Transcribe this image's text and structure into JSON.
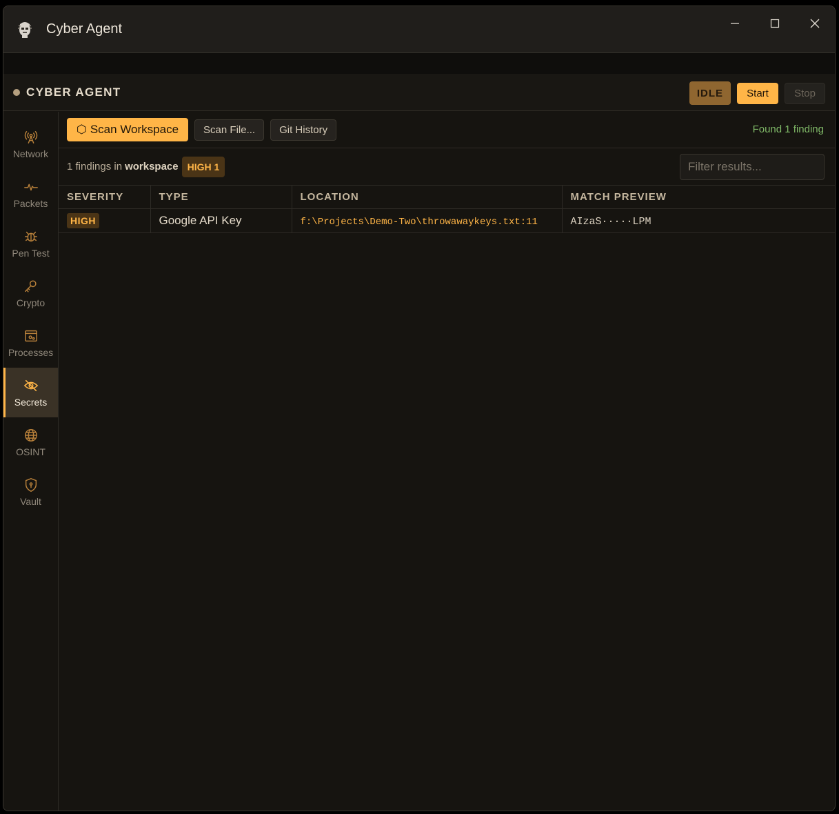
{
  "window": {
    "title": "Cyber Agent",
    "controls": [
      "minimize-icon",
      "maximize-icon",
      "close-icon"
    ]
  },
  "header": {
    "brand": "CYBER AGENT",
    "status_badge": "IDLE",
    "start_label": "Start",
    "stop_label": "Stop"
  },
  "sidebar": {
    "items": [
      {
        "label": "Network",
        "icon": "antenna-icon"
      },
      {
        "label": "Packets",
        "icon": "pulse-icon"
      },
      {
        "label": "Pen Test",
        "icon": "bug-icon"
      },
      {
        "label": "Crypto",
        "icon": "key-icon"
      },
      {
        "label": "Processes",
        "icon": "process-window-icon"
      },
      {
        "label": "Secrets",
        "icon": "eye-off-icon",
        "active": true
      },
      {
        "label": "OSINT",
        "icon": "globe-icon"
      },
      {
        "label": "Vault",
        "icon": "shield-lock-icon"
      }
    ]
  },
  "toolbar": {
    "scan_workspace_icon": "⬡",
    "scan_workspace_label": "Scan Workspace",
    "scan_file_label": "Scan File...",
    "git_history_label": "Git History",
    "status": "Found 1 finding"
  },
  "summary": {
    "prefix": "1 findings in",
    "scope": "workspace",
    "high_count": "HIGH 1",
    "filter_placeholder": "Filter results..."
  },
  "table": {
    "columns": [
      "SEVERITY",
      "TYPE",
      "LOCATION",
      "MATCH PREVIEW"
    ],
    "rows": [
      {
        "severity": "HIGH",
        "type": "Google API Key",
        "location": "f:\\Projects\\Demo-Two\\throwawaykeys.txt:11",
        "preview": "AIzaS·····LPM"
      }
    ]
  },
  "colors": {
    "accent": "#ffb547",
    "background": "#161410",
    "success": "#7fb867"
  }
}
